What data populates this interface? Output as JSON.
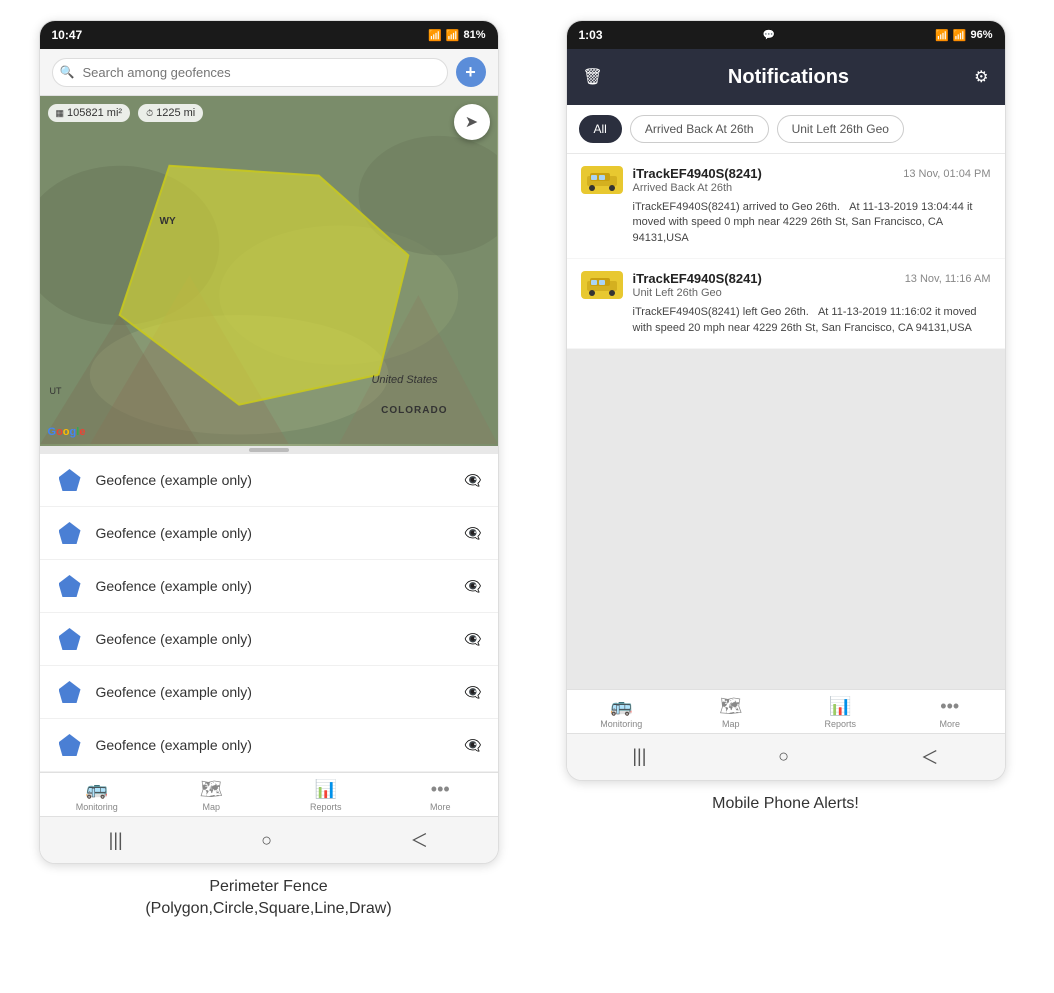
{
  "left_phone": {
    "status_bar": {
      "time": "10:47",
      "wifi": "WiFi",
      "signal": "Signal",
      "battery": "81%"
    },
    "search": {
      "placeholder": "Search among geofences",
      "add_button": "+"
    },
    "map": {
      "stat1": "105821 mi²",
      "stat2": "1225 mi",
      "label_us": "United States",
      "label_co": "COLORADO",
      "label_wy": "WY",
      "label_ut": "UT"
    },
    "geofences": [
      {
        "label": "Geofence (example only)"
      },
      {
        "label": "Geofence (example only)"
      },
      {
        "label": "Geofence (example only)"
      },
      {
        "label": "Geofence (example only)"
      },
      {
        "label": "Geofence (example only)"
      },
      {
        "label": "Geofence (example only)"
      }
    ],
    "nav": {
      "items": [
        {
          "icon": "🚌",
          "label": "Monitoring"
        },
        {
          "icon": "🗺",
          "label": "Map"
        },
        {
          "icon": "📊",
          "label": "Reports"
        },
        {
          "icon": "•••",
          "label": "More"
        }
      ]
    },
    "caption": "Perimeter Fence\n(Polygon,Circle,Square,Line,Draw)"
  },
  "right_phone": {
    "status_bar": {
      "time": "1:03",
      "battery": "96%"
    },
    "header": {
      "title": "Notifications",
      "delete_icon": "🗑",
      "settings_icon": "⚙"
    },
    "filters": {
      "items": [
        {
          "label": "All",
          "active": true
        },
        {
          "label": "Arrived Back At 26th",
          "active": false
        },
        {
          "label": "Unit Left 26th Geo",
          "active": false
        }
      ]
    },
    "notifications": [
      {
        "device": "iTrackEF4940S(8241)",
        "timestamp": "13 Nov, 01:04 PM",
        "event": "Arrived Back At 26th",
        "description": "iTrackEF4940S(8241) arrived to Geo 26th.   At 11-13-2019 13:04:44 it moved with speed 0 mph near 4229 26th St, San Francisco, CA 94131,USA"
      },
      {
        "device": "iTrackEF4940S(8241)",
        "timestamp": "13 Nov, 11:16 AM",
        "event": "Unit Left 26th Geo",
        "description": "iTrackEF4940S(8241) left Geo 26th.   At 11-13-2019 11:16:02 it moved with speed 20 mph near 4229 26th St, San Francisco, CA 94131,USA"
      }
    ],
    "nav": {
      "items": [
        {
          "icon": "🚌",
          "label": "Monitoring"
        },
        {
          "icon": "🗺",
          "label": "Map"
        },
        {
          "icon": "📊",
          "label": "Reports"
        },
        {
          "icon": "•••",
          "label": "More"
        }
      ]
    },
    "caption": "Mobile Phone Alerts!"
  }
}
